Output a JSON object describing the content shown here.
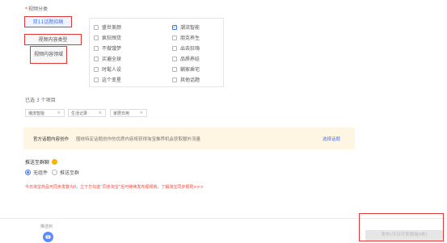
{
  "section": {
    "required_mark": "*",
    "title": "视频分类"
  },
  "category_tabs": [
    {
      "label": "双11话题招稿"
    },
    {
      "label": "视频内容类型"
    },
    {
      "label": "视频内容领域"
    }
  ],
  "checkbox_options": [
    {
      "label": "盛世美颜",
      "checked": false
    },
    {
      "label": "潮流智能",
      "checked": true
    },
    {
      "label": "疯狂囤货",
      "checked": false
    },
    {
      "label": "朋克养生",
      "checked": false
    },
    {
      "label": "不做饿梦",
      "checked": false
    },
    {
      "label": "出去狂嗨",
      "checked": false
    },
    {
      "label": "买遍全球",
      "checked": false
    },
    {
      "label": "品质养娃",
      "checked": false
    },
    {
      "label": "时髦人设",
      "checked": false
    },
    {
      "label": "躺家乘宅",
      "checked": false
    },
    {
      "label": "这个变星",
      "checked": false
    },
    {
      "label": "其他话题",
      "checked": false
    }
  ],
  "selected": {
    "prefix": "已选",
    "count": "3",
    "suffix": "个项目"
  },
  "selected_tags": [
    {
      "label": "潮流智能",
      "close": "×"
    },
    {
      "label": "生活记录",
      "close": "×"
    },
    {
      "label": "家居日用",
      "close": "×"
    }
  ],
  "banner": {
    "title": "官方话题内容创作",
    "description": "围绕特定话题创作的优质内容将获得淘宝推荐机会获取额外流量",
    "link": "选择话题"
  },
  "push": {
    "label": "推送至群聊",
    "options": [
      {
        "label": "无组件",
        "selected": true
      },
      {
        "label": "推送至群",
        "selected": false
      }
    ]
  },
  "warning": "今日淘宝商品可同步发数为0，立下方勾选“同步淘宝”后可继续发布视频商，了解淘宝同步规则>>>",
  "footer": {
    "tool_label": "推送到",
    "tool_icon": "message-icon",
    "publish_label": "发布(今日可发微淘0条)"
  },
  "colors": {
    "accent": "#3e77ff",
    "warning": "#ff3b30",
    "highlight_border": "#e13838",
    "banner_bg": "#fff5e3"
  }
}
